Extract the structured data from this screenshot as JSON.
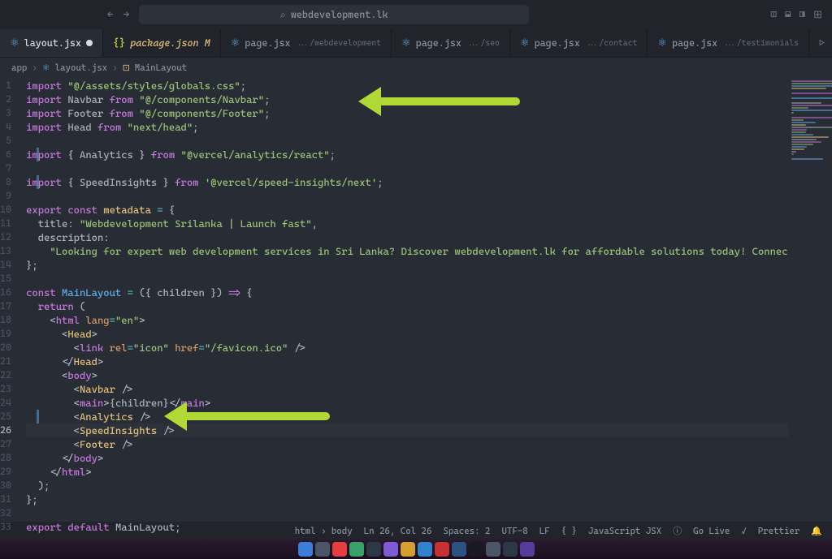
{
  "titlebar": {
    "url": "webdevelopment.lk"
  },
  "tabs": [
    {
      "icon": "react",
      "name": "layout.jsx",
      "modified": true,
      "active": true
    },
    {
      "icon": "json",
      "name": "package.json",
      "suffix": "M",
      "suffixClass": "mod"
    },
    {
      "icon": "react",
      "name": "page.jsx",
      "path": ".../webdevelopment"
    },
    {
      "icon": "react",
      "name": "page.jsx",
      "path": ".../seo"
    },
    {
      "icon": "react",
      "name": "page.jsx",
      "path": ".../contact"
    },
    {
      "icon": "react",
      "name": "page.jsx",
      "path": ".../testimonials"
    }
  ],
  "breadcrumbs": {
    "parts": [
      "app",
      "layout.jsx",
      "MainLayout"
    ]
  },
  "code": {
    "lines": [
      [
        {
          "c": "k-red",
          "t": "import"
        },
        {
          "c": "",
          "t": " "
        },
        {
          "c": "k-green",
          "t": "\"@/assets/styles/globals.css\""
        },
        {
          "c": "",
          "t": ";"
        }
      ],
      [
        {
          "c": "k-red",
          "t": "import"
        },
        {
          "c": "",
          "t": " "
        },
        {
          "c": "k-white",
          "t": "Navbar"
        },
        {
          "c": "",
          "t": " "
        },
        {
          "c": "k-red",
          "t": "from"
        },
        {
          "c": "",
          "t": " "
        },
        {
          "c": "k-green",
          "t": "\"@/components/Navbar\""
        },
        {
          "c": "",
          "t": ";"
        }
      ],
      [
        {
          "c": "k-red",
          "t": "import"
        },
        {
          "c": "",
          "t": " "
        },
        {
          "c": "k-white",
          "t": "Footer"
        },
        {
          "c": "",
          "t": " "
        },
        {
          "c": "k-red",
          "t": "from"
        },
        {
          "c": "",
          "t": " "
        },
        {
          "c": "k-green",
          "t": "\"@/components/Footer\""
        },
        {
          "c": "",
          "t": ";"
        }
      ],
      [
        {
          "c": "k-red",
          "t": "import"
        },
        {
          "c": "",
          "t": " "
        },
        {
          "c": "k-white",
          "t": "Head"
        },
        {
          "c": "",
          "t": " "
        },
        {
          "c": "k-red",
          "t": "from"
        },
        {
          "c": "",
          "t": " "
        },
        {
          "c": "k-green",
          "t": "\"next/head\""
        },
        {
          "c": "",
          "t": ";"
        }
      ],
      [],
      [
        {
          "c": "k-red",
          "t": "import"
        },
        {
          "c": "",
          "t": " { "
        },
        {
          "c": "k-white",
          "t": "Analytics"
        },
        {
          "c": "",
          "t": " } "
        },
        {
          "c": "k-red",
          "t": "from"
        },
        {
          "c": "",
          "t": " "
        },
        {
          "c": "k-green",
          "t": "\"@vercel/analytics/react\""
        },
        {
          "c": "",
          "t": ";"
        }
      ],
      [],
      [
        {
          "c": "k-red",
          "t": "import"
        },
        {
          "c": "",
          "t": " { "
        },
        {
          "c": "k-white",
          "t": "SpeedInsights"
        },
        {
          "c": "",
          "t": " } "
        },
        {
          "c": "k-red",
          "t": "from"
        },
        {
          "c": "",
          "t": " "
        },
        {
          "c": "k-green",
          "t": "'@vercel/speed-insights/next'"
        },
        {
          "c": "",
          "t": ";"
        }
      ],
      [],
      [
        {
          "c": "k-red",
          "t": "export"
        },
        {
          "c": "",
          "t": " "
        },
        {
          "c": "k-red",
          "t": "const"
        },
        {
          "c": "",
          "t": " "
        },
        {
          "c": "k-yellow",
          "t": "metadata"
        },
        {
          "c": "",
          "t": " "
        },
        {
          "c": "k-teal",
          "t": "="
        },
        {
          "c": "",
          "t": " {"
        }
      ],
      [
        {
          "c": "",
          "t": "  "
        },
        {
          "c": "k-white",
          "t": "title"
        },
        {
          "c": "",
          "t": ": "
        },
        {
          "c": "k-green",
          "t": "\"Webdevelopment Srilanka | Launch fast\""
        },
        {
          "c": "",
          "t": ","
        }
      ],
      [
        {
          "c": "",
          "t": "  "
        },
        {
          "c": "k-white",
          "t": "description"
        },
        {
          "c": "",
          "t": ":"
        }
      ],
      [
        {
          "c": "",
          "t": "    "
        },
        {
          "c": "k-green",
          "t": "\"Looking for expert web development services in Sri Lanka? Discover webdevelopment.lk for affordable solutions today! Connec"
        }
      ],
      [
        {
          "c": "",
          "t": "};"
        }
      ],
      [],
      [
        {
          "c": "k-red",
          "t": "const"
        },
        {
          "c": "",
          "t": " "
        },
        {
          "c": "k-blue",
          "t": "MainLayout"
        },
        {
          "c": "",
          "t": " "
        },
        {
          "c": "k-teal",
          "t": "="
        },
        {
          "c": "",
          "t": " ({ "
        },
        {
          "c": "k-white",
          "t": "children"
        },
        {
          "c": "",
          "t": " }) "
        },
        {
          "c": "k-red",
          "t": "=>"
        },
        {
          "c": "",
          "t": " {"
        }
      ],
      [
        {
          "c": "",
          "t": "  "
        },
        {
          "c": "k-red",
          "t": "return"
        },
        {
          "c": "",
          "t": " ("
        }
      ],
      [
        {
          "c": "",
          "t": "    <"
        },
        {
          "c": "k-red",
          "t": "html"
        },
        {
          "c": "",
          "t": " "
        },
        {
          "c": "k-orange",
          "t": "lang"
        },
        {
          "c": "k-teal",
          "t": "="
        },
        {
          "c": "k-green",
          "t": "\"en\""
        },
        {
          "c": "",
          "t": ">"
        }
      ],
      [
        {
          "c": "",
          "t": "      <"
        },
        {
          "c": "k-yellow",
          "t": "Head"
        },
        {
          "c": "",
          "t": ">"
        }
      ],
      [
        {
          "c": "",
          "t": "        <"
        },
        {
          "c": "k-red",
          "t": "link"
        },
        {
          "c": "",
          "t": " "
        },
        {
          "c": "k-orange",
          "t": "rel"
        },
        {
          "c": "k-teal",
          "t": "="
        },
        {
          "c": "k-green",
          "t": "\"icon\""
        },
        {
          "c": "",
          "t": " "
        },
        {
          "c": "k-orange",
          "t": "href"
        },
        {
          "c": "k-teal",
          "t": "="
        },
        {
          "c": "k-green",
          "t": "\"/favicon.ico\""
        },
        {
          "c": "",
          "t": " />"
        }
      ],
      [
        {
          "c": "",
          "t": "      </"
        },
        {
          "c": "k-yellow",
          "t": "Head"
        },
        {
          "c": "",
          "t": ">"
        }
      ],
      [
        {
          "c": "",
          "t": "      <"
        },
        {
          "c": "k-red",
          "t": "body"
        },
        {
          "c": "",
          "t": ">"
        }
      ],
      [
        {
          "c": "",
          "t": "        <"
        },
        {
          "c": "k-yellow",
          "t": "Navbar"
        },
        {
          "c": "",
          "t": " />"
        }
      ],
      [
        {
          "c": "",
          "t": "        <"
        },
        {
          "c": "k-red",
          "t": "main"
        },
        {
          "c": "",
          "t": ">{"
        },
        {
          "c": "k-white",
          "t": "children"
        },
        {
          "c": "",
          "t": "}</"
        },
        {
          "c": "k-red",
          "t": "main"
        },
        {
          "c": "",
          "t": ">"
        }
      ],
      [
        {
          "c": "",
          "t": "        <"
        },
        {
          "c": "k-yellow",
          "t": "Analytics"
        },
        {
          "c": "",
          "t": " />"
        }
      ],
      [
        {
          "c": "",
          "t": "        <"
        },
        {
          "c": "k-yellow",
          "t": "SpeedInsights"
        },
        {
          "c": "",
          "t": " />"
        }
      ],
      [
        {
          "c": "",
          "t": "        <"
        },
        {
          "c": "k-yellow",
          "t": "Footer"
        },
        {
          "c": "",
          "t": " />"
        }
      ],
      [
        {
          "c": "",
          "t": "      </"
        },
        {
          "c": "k-red",
          "t": "body"
        },
        {
          "c": "",
          "t": ">"
        }
      ],
      [
        {
          "c": "",
          "t": "    </"
        },
        {
          "c": "k-red",
          "t": "html"
        },
        {
          "c": "",
          "t": ">"
        }
      ],
      [
        {
          "c": "",
          "t": "  );"
        }
      ],
      [
        {
          "c": "",
          "t": "};"
        }
      ],
      [],
      [
        {
          "c": "k-red",
          "t": "export"
        },
        {
          "c": "",
          "t": " "
        },
        {
          "c": "k-red",
          "t": "default"
        },
        {
          "c": "",
          "t": " "
        },
        {
          "c": "k-white",
          "t": "MainLayout"
        },
        {
          "c": "",
          "t": ";"
        }
      ]
    ],
    "activeLine": 26
  },
  "statusbar": {
    "path": "html › body",
    "pos": "Ln 26, Col 26",
    "spaces": "Spaces: 2",
    "encoding": "UTF-8",
    "eol": "LF",
    "lang": "JavaScript JSX",
    "golive": "Go Live",
    "prettier": "Prettier"
  }
}
